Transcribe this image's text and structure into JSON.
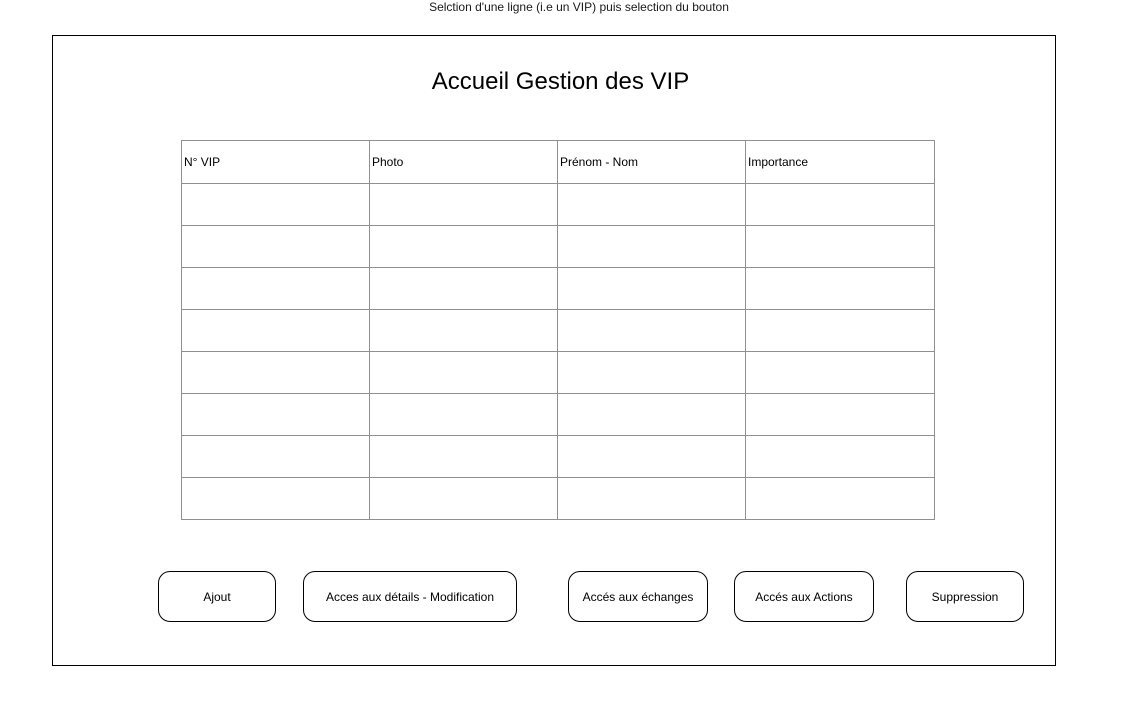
{
  "note": "Selction d'une ligne (i.e un VIP) puis selection du bouton",
  "page_title": "Accueil Gestion des VIP",
  "table": {
    "headers": [
      "N° VIP",
      "Photo",
      "Prénom - Nom",
      "Importance"
    ],
    "rows": [
      [
        "",
        "",
        "",
        ""
      ],
      [
        "",
        "",
        "",
        ""
      ],
      [
        "",
        "",
        "",
        ""
      ],
      [
        "",
        "",
        "",
        ""
      ],
      [
        "",
        "",
        "",
        ""
      ],
      [
        "",
        "",
        "",
        ""
      ],
      [
        "",
        "",
        "",
        ""
      ],
      [
        "",
        "",
        "",
        ""
      ]
    ]
  },
  "buttons": {
    "add": "Ajout",
    "details": "Acces aux détails - Modification",
    "exchanges": "Accés aux échanges",
    "actions": "Accés aux Actions",
    "delete": "Suppression"
  }
}
